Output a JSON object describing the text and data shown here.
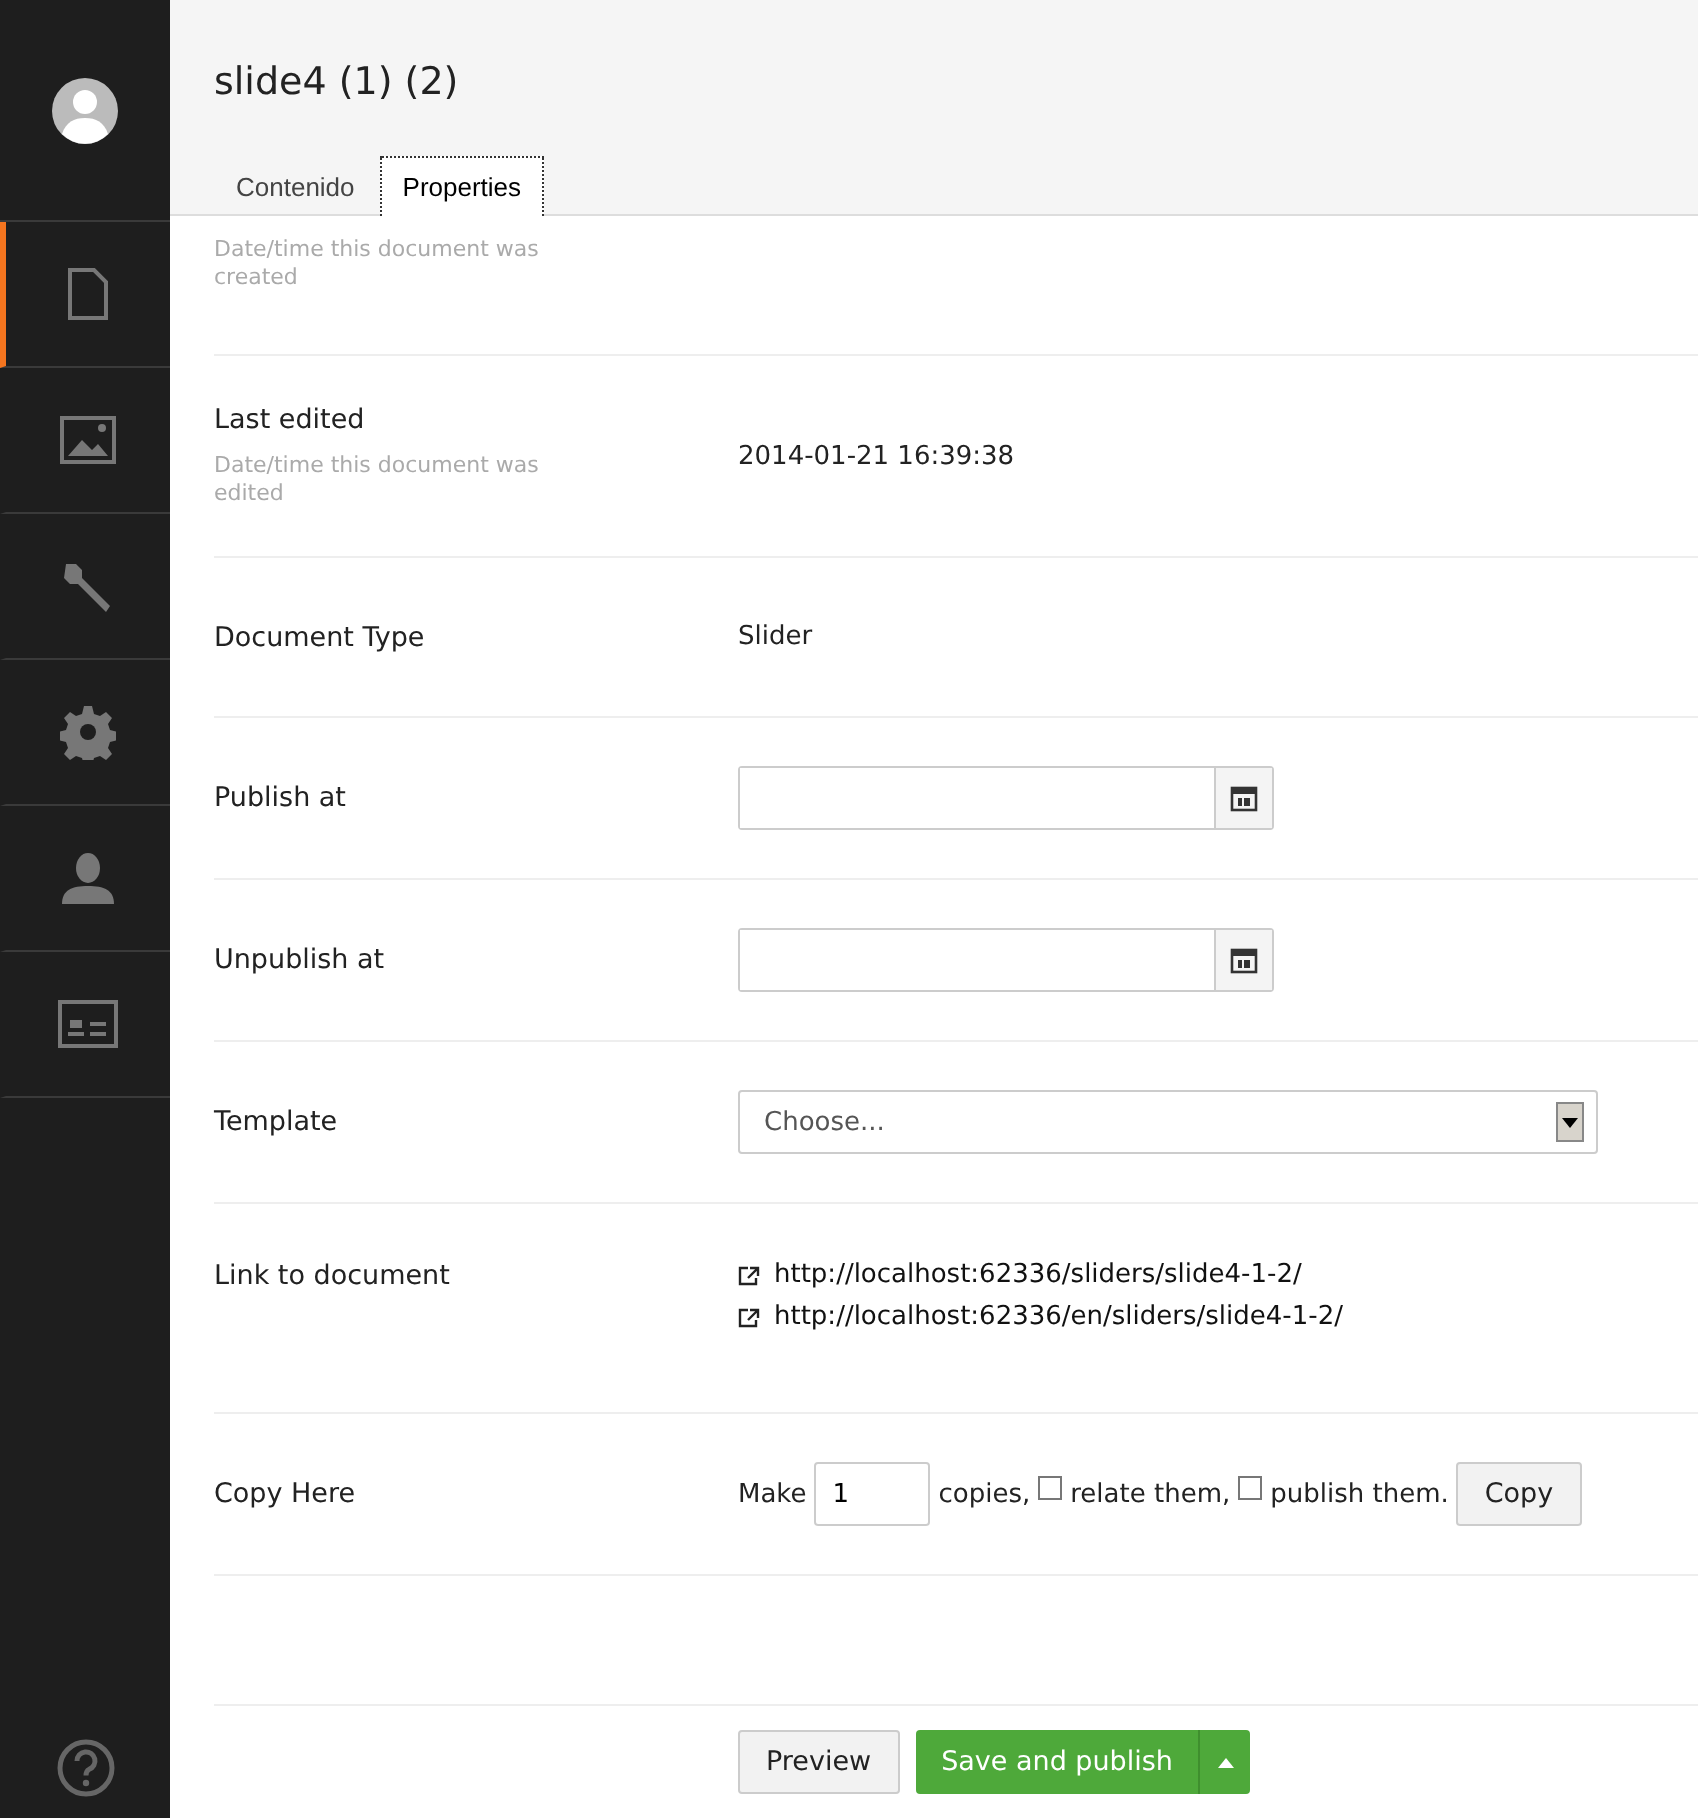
{
  "sidebar": {
    "items": [
      {
        "kind": "document",
        "selected": true
      },
      {
        "kind": "image",
        "selected": false
      },
      {
        "kind": "wrench",
        "selected": false
      },
      {
        "kind": "gear",
        "selected": false
      },
      {
        "kind": "user",
        "selected": false
      },
      {
        "kind": "card",
        "selected": false
      }
    ]
  },
  "header": {
    "title": "slide4 (1) (2)"
  },
  "tabs": [
    {
      "label": "Contenido",
      "selected": false
    },
    {
      "label": "Properties",
      "selected": true
    }
  ],
  "properties": [
    {
      "kind": "text",
      "description": "Date/time this document was created"
    },
    {
      "kind": "text",
      "label": "Last edited",
      "description": "Date/time this document was edited",
      "value": "2014-01-21 16:39:38"
    },
    {
      "kind": "text",
      "label": "Document Type",
      "value": "Slider"
    },
    {
      "kind": "date",
      "label": "Publish at"
    },
    {
      "kind": "date",
      "label": "Unpublish at"
    },
    {
      "kind": "select",
      "label": "Template",
      "value": "Choose..."
    },
    {
      "kind": "links",
      "label": "Link to document",
      "links": [
        "http://localhost:62336/sliders/slide4-1-2/",
        "http://localhost:62336/en/sliders/slide4-1-2/"
      ]
    },
    {
      "kind": "copy",
      "label": "Copy Here",
      "prefix": "Make",
      "count": "1",
      "copies_text": "copies,",
      "relate": {
        "label": "relate them,",
        "checked": false
      },
      "publish": {
        "label": "publish them.",
        "checked": false
      },
      "button": "Copy"
    }
  ],
  "footer": {
    "preview": "Preview",
    "save": "Save and publish"
  }
}
